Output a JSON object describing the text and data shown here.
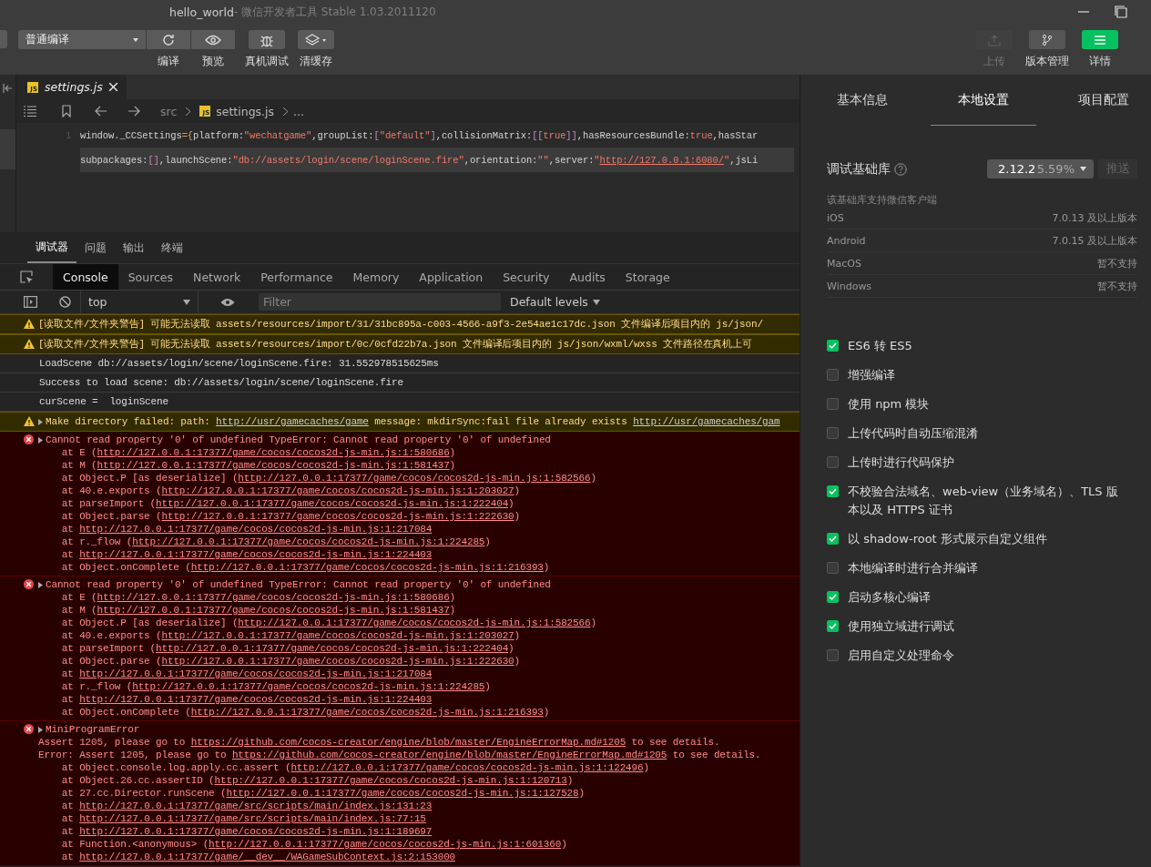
{
  "window": {
    "title": "hello_world",
    "subtitle": " - 微信开发者工具 Stable 1.03.2011120"
  },
  "toolbar": {
    "compile_mode": "普通编译",
    "left_buttons": [
      {
        "kind": "compile",
        "label": "编译"
      },
      {
        "kind": "preview",
        "label": "预览"
      },
      {
        "kind": "debug",
        "label": "真机调试"
      },
      {
        "kind": "cache",
        "label": "清缓存"
      }
    ],
    "right_buttons": [
      {
        "kind": "upload",
        "label": "上传",
        "disabled": true
      },
      {
        "kind": "version",
        "label": "版本管理",
        "disabled": false
      },
      {
        "kind": "details",
        "label": "详情",
        "disabled": false
      }
    ]
  },
  "editor": {
    "tab": {
      "file": "settings.js",
      "badge": "JS"
    },
    "breadcrumb": {
      "folder": "src",
      "badge": "JS",
      "file": "settings.js",
      "more": "..."
    },
    "rows": [
      {
        "number": "1",
        "highlighted": false,
        "tokens": [
          {
            "text": "window._CCSettings",
            "kind": "plain"
          },
          {
            "text": "={",
            "kind": "punct"
          },
          {
            "text": "platform:",
            "kind": "plain"
          },
          {
            "text": "\"wechatgame\"",
            "kind": "string"
          },
          {
            "text": ",groupList:",
            "kind": "plain"
          },
          {
            "text": "[",
            "kind": "bracket"
          },
          {
            "text": "\"default\"",
            "kind": "string"
          },
          {
            "text": "]",
            "kind": "bracket"
          },
          {
            "text": ",collisionMatrix:",
            "kind": "plain"
          },
          {
            "text": "[[",
            "kind": "bracket"
          },
          {
            "text": "true",
            "kind": "bool"
          },
          {
            "text": "]]",
            "kind": "bracket"
          },
          {
            "text": ",hasResourcesBundle:",
            "kind": "plain"
          },
          {
            "text": "true",
            "kind": "bool"
          },
          {
            "text": ",hasStar",
            "kind": "plain"
          }
        ]
      },
      {
        "highlighted": true,
        "tokens": [
          {
            "text": "subpackages:",
            "kind": "plain"
          },
          {
            "text": "[]",
            "kind": "bracket"
          },
          {
            "text": ",launchScene:",
            "kind": "plain"
          },
          {
            "text": "\"db://assets/login/scene/loginScene.fire\"",
            "kind": "string"
          },
          {
            "text": ",orientation:",
            "kind": "plain"
          },
          {
            "text": "\"\"",
            "kind": "string"
          },
          {
            "text": ",server:",
            "kind": "plain"
          },
          {
            "text": "\"",
            "kind": "string"
          },
          {
            "text": "http://127.0.0.1:6080/",
            "kind": "url"
          },
          {
            "text": "\"",
            "kind": "string"
          },
          {
            "text": ",jsLi",
            "kind": "plain"
          }
        ]
      }
    ]
  },
  "devtools": {
    "panel_tabs": [
      {
        "label": "调试器",
        "selected": true
      },
      {
        "label": "问题",
        "selected": false
      },
      {
        "label": "输出",
        "selected": false
      },
      {
        "label": "终端",
        "selected": false
      }
    ],
    "tabs": [
      {
        "label": "Console",
        "selected": true
      },
      {
        "label": "Sources",
        "selected": false
      },
      {
        "label": "Network",
        "selected": false
      },
      {
        "label": "Performance",
        "selected": false
      },
      {
        "label": "Memory",
        "selected": false
      },
      {
        "label": "Application",
        "selected": false
      },
      {
        "label": "Security",
        "selected": false
      },
      {
        "label": "Audits",
        "selected": false
      },
      {
        "label": "Storage",
        "selected": false
      }
    ],
    "context": "top",
    "filter": {
      "placeholder": "Filter"
    },
    "levels": "Default levels",
    "messages": [
      {
        "kind": "warning",
        "expandable": false,
        "lines": [
          [
            "[读取文件/文件夹警告] 可能无法读取 assets/resources/import/31/31bc895a-c003-4566-a9f3-2e54ae1c17dc.json 文件编译后项目内的 js/json/"
          ]
        ]
      },
      {
        "kind": "warning",
        "expandable": false,
        "lines": [
          [
            "[读取文件/文件夹警告] 可能无法读取 assets/resources/import/0c/0cfd22b7a.json 文件编译后项目内的 js/json/wxml/wxss 文件路径在真机上可"
          ]
        ]
      },
      {
        "kind": "log",
        "expandable": false,
        "lines": [
          [
            "LoadScene db://assets/login/scene/loginScene.fire: 31.552978515625ms"
          ]
        ]
      },
      {
        "kind": "log",
        "expandable": false,
        "lines": [
          [
            "Success to load scene: db://assets/login/scene/loginScene.fire"
          ]
        ]
      },
      {
        "kind": "log",
        "expandable": false,
        "lines": [
          [
            "curScene =  loginScene"
          ]
        ]
      },
      {
        "kind": "warning",
        "expandable": true,
        "lines": [
          [
            "Make directory failed: path: ",
            "http://usr/gamecaches/game",
            " message: mkdirSync:fail file already exists ",
            "http://usr/gamecaches/gam"
          ]
        ]
      },
      {
        "kind": "error",
        "expandable": true,
        "lines": [
          [
            "Cannot read property '0' of undefined TypeError: Cannot read property '0' of undefined"
          ],
          [
            "    at E (",
            "http://127.0.0.1:17377/game/cocos/cocos2d-js-min.js:1:580686",
            ")"
          ],
          [
            "    at M (",
            "http://127.0.0.1:17377/game/cocos/cocos2d-js-min.js:1:581437",
            ")"
          ],
          [
            "    at Object.P [as deserialize] (",
            "http://127.0.0.1:17377/game/cocos/cocos2d-js-min.js:1:582566",
            ")"
          ],
          [
            "    at 40.e.exports (",
            "http://127.0.0.1:17377/game/cocos/cocos2d-js-min.js:1:203027",
            ")"
          ],
          [
            "    at parseImport (",
            "http://127.0.0.1:17377/game/cocos/cocos2d-js-min.js:1:222404",
            ")"
          ],
          [
            "    at Object.parse (",
            "http://127.0.0.1:17377/game/cocos/cocos2d-js-min.js:1:222630",
            ")"
          ],
          [
            "    at ",
            "http://127.0.0.1:17377/game/cocos/cocos2d-js-min.js:1:217084"
          ],
          [
            "    at r._flow (",
            "http://127.0.0.1:17377/game/cocos/cocos2d-js-min.js:1:224285",
            ")"
          ],
          [
            "    at ",
            "http://127.0.0.1:17377/game/cocos/cocos2d-js-min.js:1:224403"
          ],
          [
            "    at Object.onComplete (",
            "http://127.0.0.1:17377/game/cocos/cocos2d-js-min.js:1:216393",
            ")"
          ]
        ]
      },
      {
        "kind": "error",
        "expandable": true,
        "lines": [
          [
            "Cannot read property '0' of undefined TypeError: Cannot read property '0' of undefined"
          ],
          [
            "    at E (",
            "http://127.0.0.1:17377/game/cocos/cocos2d-js-min.js:1:580686",
            ")"
          ],
          [
            "    at M (",
            "http://127.0.0.1:17377/game/cocos/cocos2d-js-min.js:1:581437",
            ")"
          ],
          [
            "    at Object.P [as deserialize] (",
            "http://127.0.0.1:17377/game/cocos/cocos2d-js-min.js:1:582566",
            ")"
          ],
          [
            "    at 40.e.exports (",
            "http://127.0.0.1:17377/game/cocos/cocos2d-js-min.js:1:203027",
            ")"
          ],
          [
            "    at parseImport (",
            "http://127.0.0.1:17377/game/cocos/cocos2d-js-min.js:1:222404",
            ")"
          ],
          [
            "    at Object.parse (",
            "http://127.0.0.1:17377/game/cocos/cocos2d-js-min.js:1:222630",
            ")"
          ],
          [
            "    at ",
            "http://127.0.0.1:17377/game/cocos/cocos2d-js-min.js:1:217084"
          ],
          [
            "    at r._flow (",
            "http://127.0.0.1:17377/game/cocos/cocos2d-js-min.js:1:224285",
            ")"
          ],
          [
            "    at ",
            "http://127.0.0.1:17377/game/cocos/cocos2d-js-min.js:1:224403"
          ],
          [
            "    at Object.onComplete (",
            "http://127.0.0.1:17377/game/cocos/cocos2d-js-min.js:1:216393",
            ")"
          ]
        ]
      },
      {
        "kind": "error",
        "expandable": true,
        "lines": [
          [
            "MiniProgramError"
          ],
          [
            "Assert 1205, please go to ",
            "https://github.com/cocos-creator/engine/blob/master/EngineErrorMap.md#1205",
            " to see details."
          ],
          [
            "Error: Assert 1205, please go to ",
            "https://github.com/cocos-creator/engine/blob/master/EngineErrorMap.md#1205",
            " to see details."
          ],
          [
            "    at Object.console.log.apply.cc.assert (",
            "http://127.0.0.1:17377/game/cocos/cocos2d-js-min.js:1:122496",
            ")"
          ],
          [
            "    at Object.26.cc.assertID (",
            "http://127.0.0.1:17377/game/cocos/cocos2d-js-min.js:1:120713",
            ")"
          ],
          [
            "    at 27.cc.Director.runScene (",
            "http://127.0.0.1:17377/game/cocos/cocos2d-js-min.js:1:127528",
            ")"
          ],
          [
            "    at ",
            "http://127.0.0.1:17377/game/src/scripts/main/index.js:131:23"
          ],
          [
            "    at ",
            "http://127.0.0.1:17377/game/src/scripts/main/index.js:77:15"
          ],
          [
            "    at ",
            "http://127.0.0.1:17377/game/cocos/cocos2d-js-min.js:1:189697"
          ],
          [
            "    at Function.<anonymous> (",
            "http://127.0.0.1:17377/game/cocos/cocos2d-js-min.js:1:601360",
            ")"
          ],
          [
            "    at ",
            "http://127.0.0.1:17377/game/__dev__/WAGameSubContext.js:2:153000"
          ]
        ]
      }
    ]
  },
  "details": {
    "tabs": [
      {
        "label": "基本信息",
        "selected": false
      },
      {
        "label": "本地设置",
        "selected": true
      },
      {
        "label": "项目配置",
        "selected": false
      }
    ],
    "base_library": {
      "label": "调试基础库",
      "version": "2.12.2",
      "share": "5.59%",
      "push_button": "推送",
      "push_disabled": true
    },
    "support_title": "该基础库支持微信客户端",
    "support": [
      {
        "platform": "iOS",
        "value": "7.0.13 及以上版本"
      },
      {
        "platform": "Android",
        "value": "7.0.15 及以上版本"
      },
      {
        "platform": "MacOS",
        "value": "暂不支持"
      },
      {
        "platform": "Windows",
        "value": "暂不支持"
      }
    ],
    "options": [
      {
        "label": "ES6 转 ES5",
        "checked": true
      },
      {
        "label": "增强编译",
        "checked": false
      },
      {
        "label": "使用 npm 模块",
        "checked": false
      },
      {
        "label": "上传代码时自动压缩混淆",
        "checked": false
      },
      {
        "label": "上传时进行代码保护",
        "checked": false
      },
      {
        "label": "不校验合法域名、web-view（业务域名）、TLS 版本以及 HTTPS 证书",
        "checked": true
      },
      {
        "label": "以 shadow-root 形式展示自定义组件",
        "checked": true
      },
      {
        "label": "本地编译时进行合并编译",
        "checked": false
      },
      {
        "label": "启动多核心编译",
        "checked": true
      },
      {
        "label": "使用独立域进行调试",
        "checked": true
      },
      {
        "label": "启用自定义处理命令",
        "checked": false
      }
    ]
  }
}
